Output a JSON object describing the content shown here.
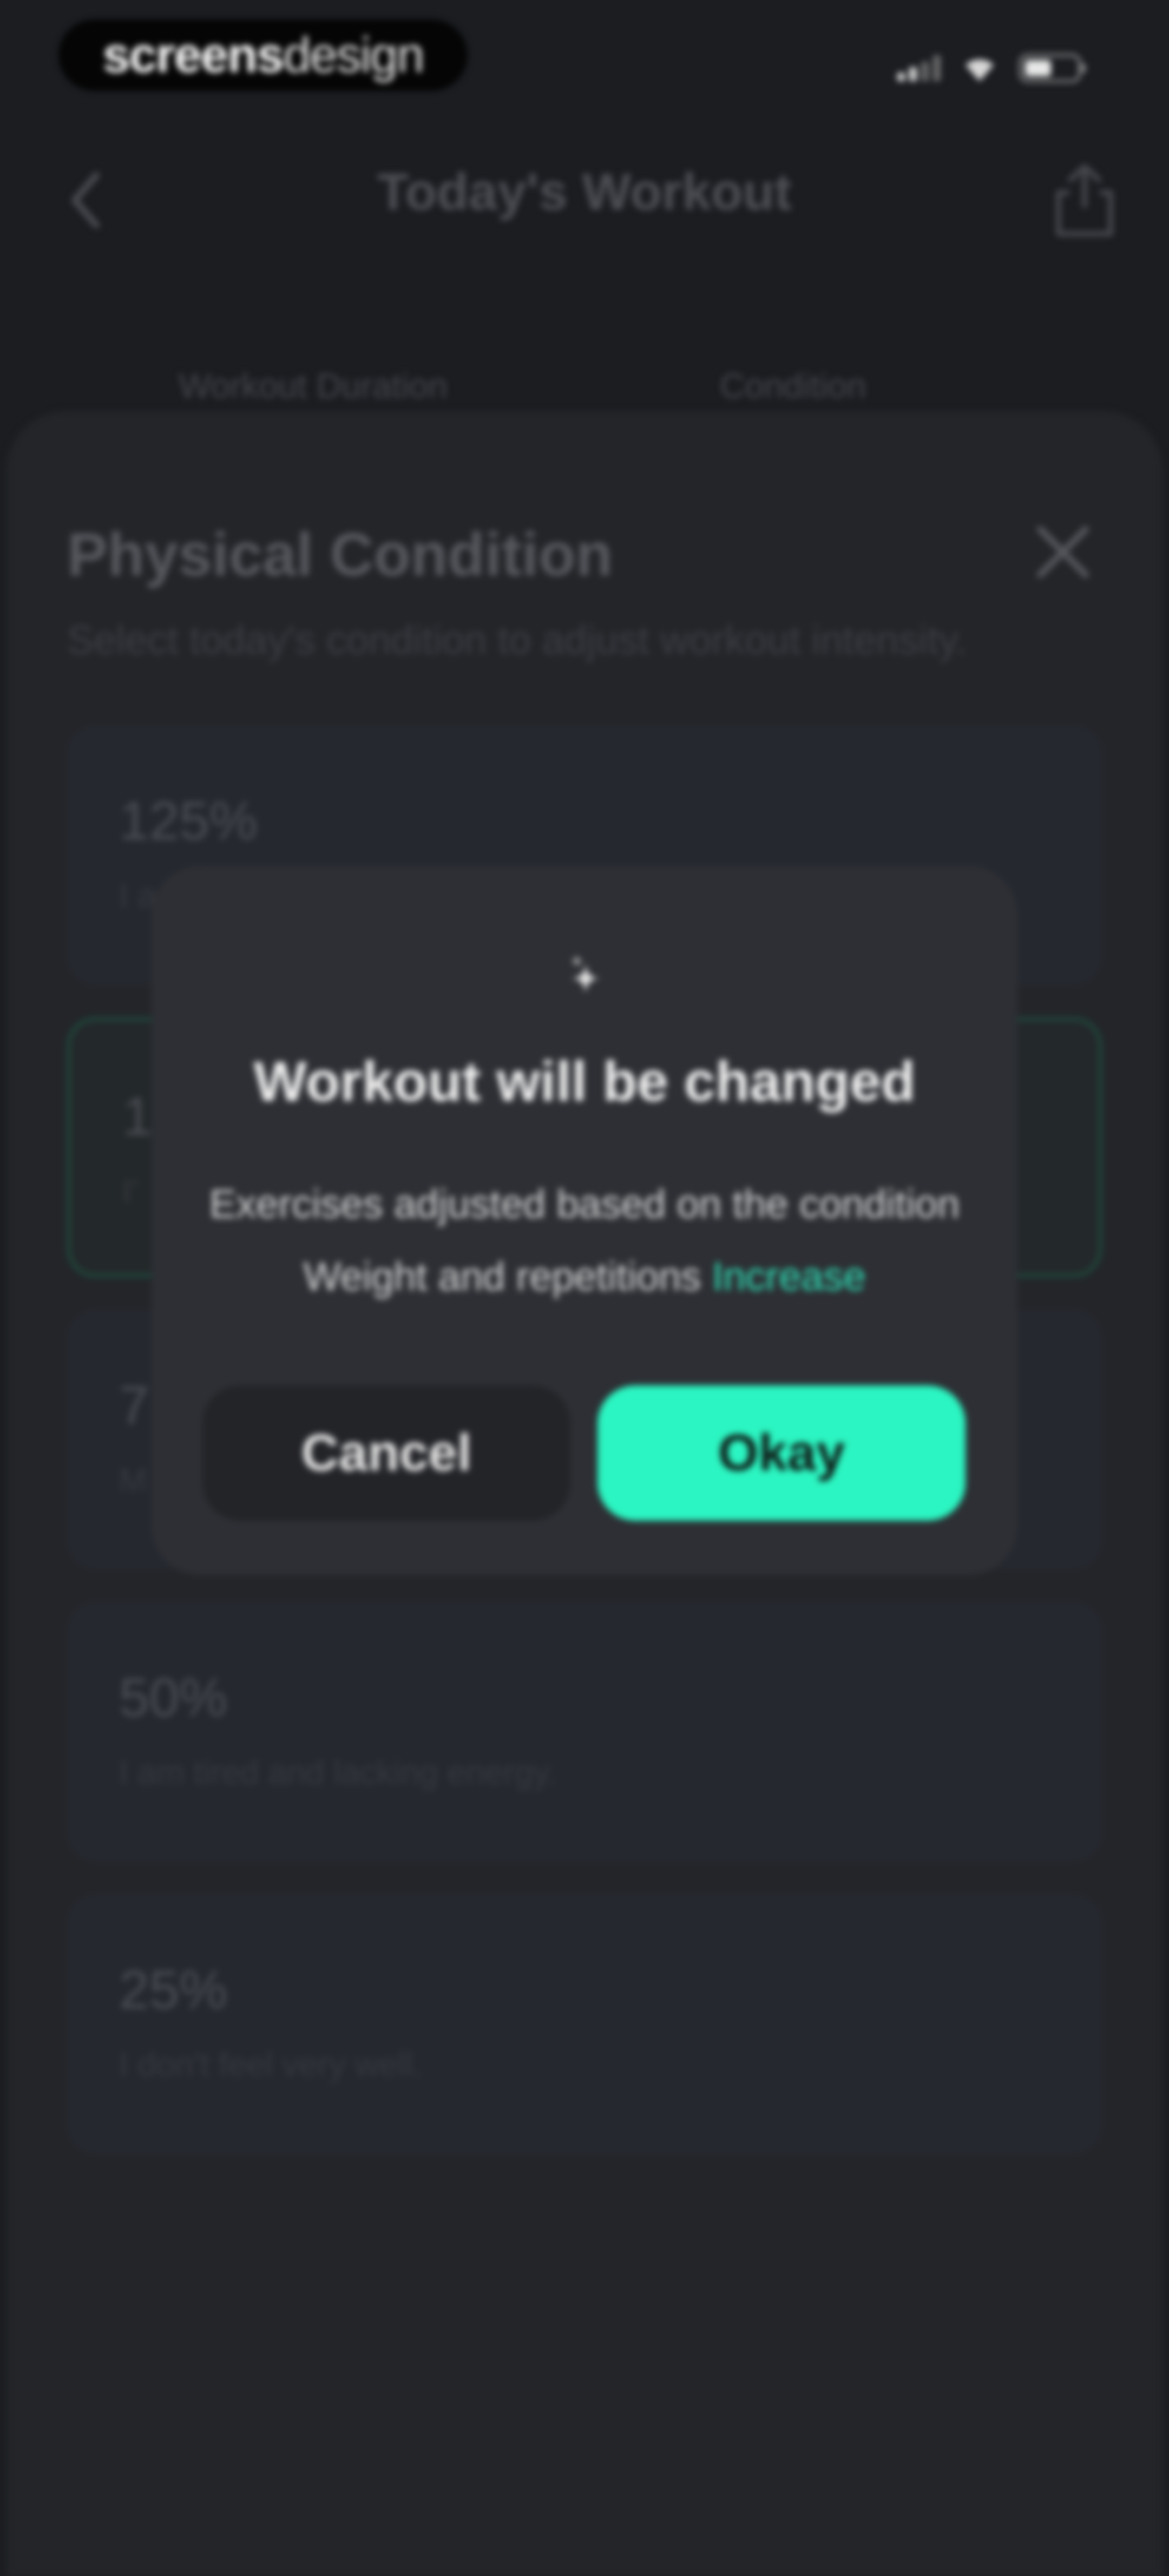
{
  "watermark": {
    "bold": "screens",
    "light": "design"
  },
  "nav": {
    "title": "Today's Workout"
  },
  "chips": {
    "duration_label": "Workout Duration",
    "condition_label": "Condition"
  },
  "sheet": {
    "title": "Physical Condition",
    "subtitle": "Select today's condition to adjust workout intensity.",
    "options": [
      {
        "percent": "125%",
        "description": "I a",
        "selected": false
      },
      {
        "percent": "1",
        "description": "I'",
        "selected": true
      },
      {
        "percent": "7",
        "description": "M",
        "selected": false
      },
      {
        "percent": "50%",
        "description": "I am tired and lacking energy.",
        "selected": false
      },
      {
        "percent": "25%",
        "description": "I don't feel very well.",
        "selected": false
      }
    ]
  },
  "dialog": {
    "title": "Workout will be changed",
    "line1": "Exercises adjusted based on the condition",
    "line2_prefix": "Weight and repetitions ",
    "line2_accent": "Increase",
    "cancel_label": "Cancel",
    "okay_label": "Okay"
  },
  "colors": {
    "background": "#1b1d21",
    "sheet": "#232529",
    "dialog": "#2d2f34",
    "accent": "#2bf5c2",
    "accent_text": "#2ee0b6"
  },
  "icons": {
    "back": "chevron-left-icon",
    "share": "share-icon",
    "close": "close-icon",
    "sparkle": "sparkle-icon",
    "signal": "signal-icon",
    "wifi": "wifi-icon",
    "battery": "battery-icon"
  }
}
